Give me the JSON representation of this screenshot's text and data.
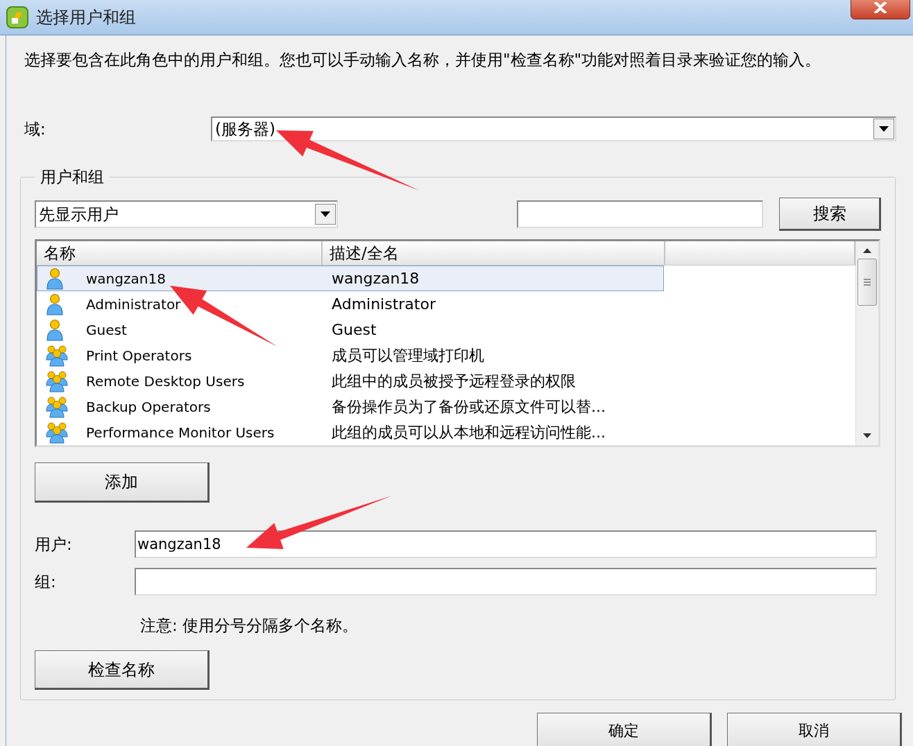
{
  "window": {
    "title": "选择用户和组"
  },
  "description": "选择要包含在此角色中的用户和组。您也可以手动输入名称，并使用\"检查名称\"功能对照着目录来验证您的输入。",
  "domain": {
    "label": "域:",
    "value": "(服务器)"
  },
  "group_box": {
    "title": "用户和组",
    "filter": {
      "value": "先显示用户"
    },
    "search_button": "搜索",
    "table": {
      "columns": [
        "名称",
        "描述/全名"
      ],
      "rows": [
        {
          "kind": "user",
          "name": "wangzan18",
          "description": "wangzan18",
          "selected": true
        },
        {
          "kind": "user",
          "name": "Administrator",
          "description": "Administrator",
          "selected": false
        },
        {
          "kind": "user",
          "name": "Guest",
          "description": "Guest",
          "selected": false
        },
        {
          "kind": "group",
          "name": "Print Operators",
          "description": "成员可以管理域打印机",
          "selected": false
        },
        {
          "kind": "group",
          "name": "Remote Desktop Users",
          "description": "此组中的成员被授予远程登录的权限",
          "selected": false
        },
        {
          "kind": "group",
          "name": "Backup Operators",
          "description": "备份操作员为了备份或还原文件可以替...",
          "selected": false
        },
        {
          "kind": "group",
          "name": "Performance Monitor Users",
          "description": "此组的成员可以从本地和远程访问性能...",
          "selected": false
        }
      ]
    },
    "add_button": "添加",
    "users": {
      "label": "用户:",
      "value": "wangzan18"
    },
    "groups": {
      "label": "组:"
    },
    "note": "注意: 使用分号分隔多个名称。",
    "check_button": "检查名称"
  },
  "buttons": [
    "确定",
    "取消"
  ]
}
